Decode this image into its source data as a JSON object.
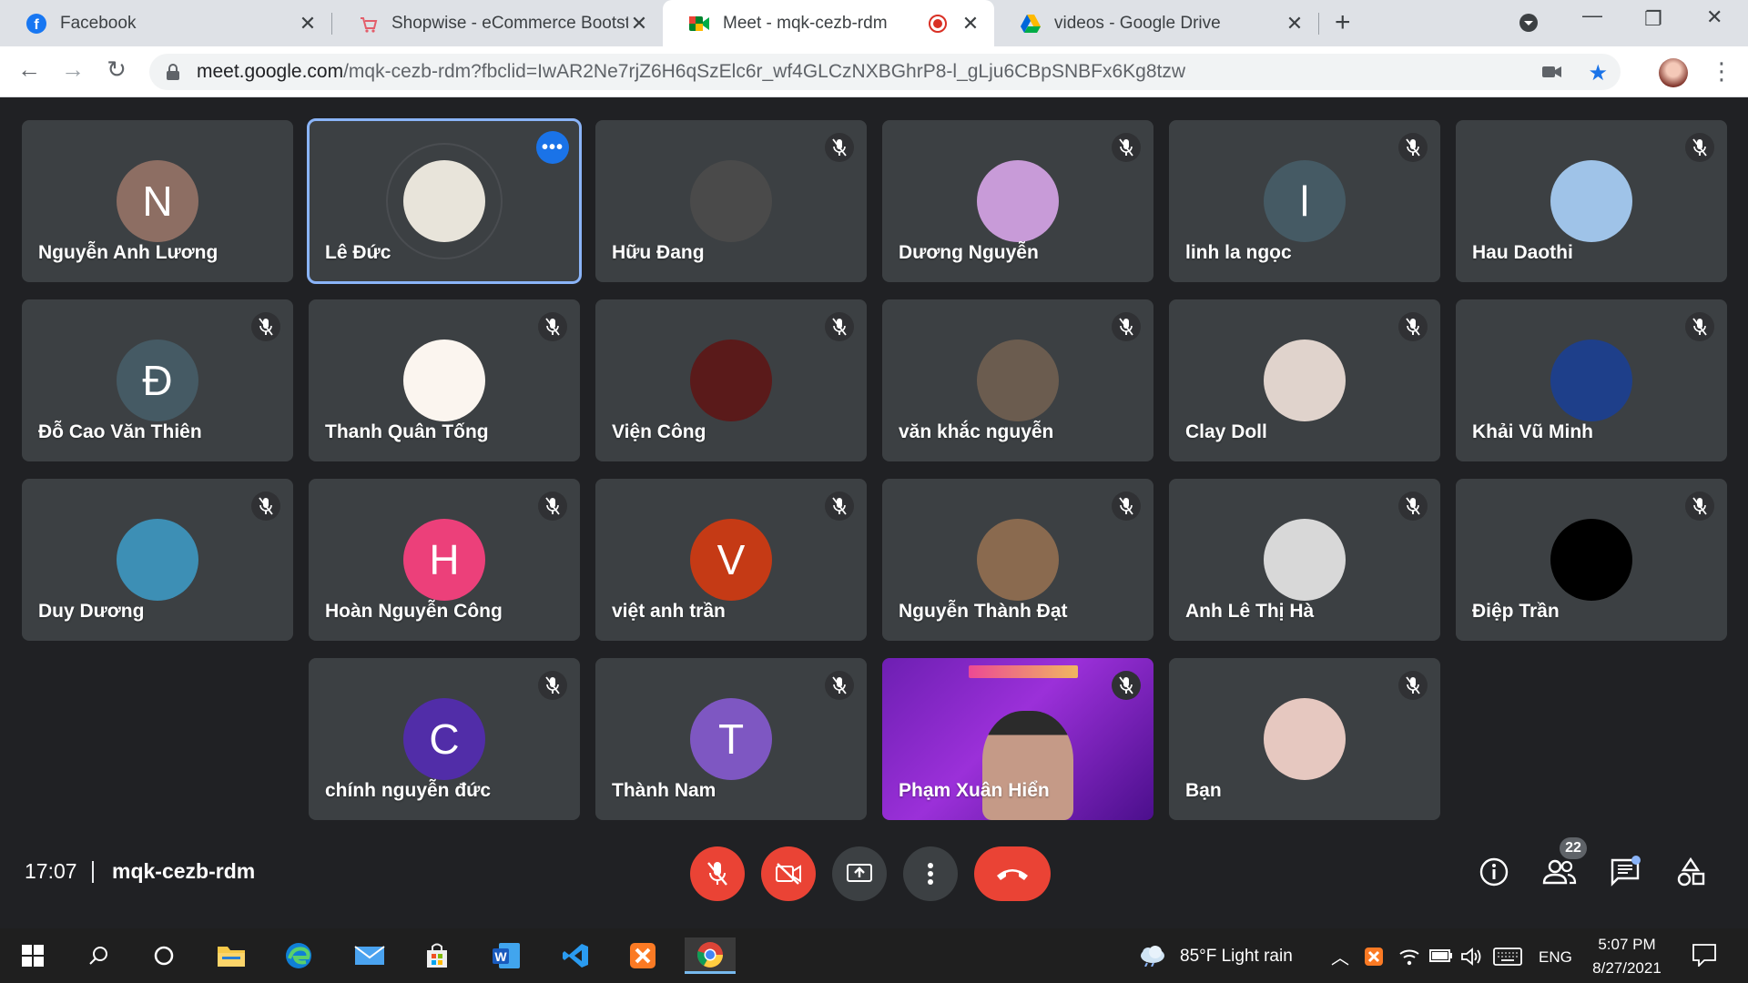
{
  "browser": {
    "tabs": [
      {
        "title": "Facebook",
        "icon": "facebook-icon",
        "active": false
      },
      {
        "title": "Shopwise - eCommerce Bootstra",
        "icon": "shop-icon",
        "active": false
      },
      {
        "title": "Meet - mqk-cezb-rdm",
        "icon": "meet-icon",
        "active": true
      },
      {
        "title": "videos - Google Drive",
        "icon": "drive-icon",
        "active": false
      }
    ],
    "url_host": "meet.google.com",
    "url_path": "/mqk-cezb-rdm?fbclid=IwAR2Ne7rjZ6H6qSzElc6r_wf4GLCzNXBGhrP8-l_gLju6CBpSNBFx6Kg8tzw"
  },
  "participants": [
    {
      "name": "Nguyễn Anh Lương",
      "initial": "N",
      "avatar_color": "#8d6e63",
      "muted": false
    },
    {
      "name": "Lê Đức",
      "initial": "",
      "avatar_color": "#e8e4da",
      "muted": false,
      "speaking": true
    },
    {
      "name": "Hữu Đang",
      "initial": "",
      "avatar_color": "#4a4a4a",
      "muted": true
    },
    {
      "name": "Dương Nguyễn",
      "initial": "",
      "avatar_color": "#c89bd8",
      "muted": true
    },
    {
      "name": "linh la ngọc",
      "initial": "l",
      "avatar_color": "#455a64",
      "muted": true
    },
    {
      "name": "Hau Daothi",
      "initial": "",
      "avatar_color": "#9fc3e8",
      "muted": true
    },
    {
      "name": "Đỗ Cao Văn Thiên",
      "initial": "Đ",
      "avatar_color": "#455a64",
      "muted": true
    },
    {
      "name": "Thanh Quân Tống",
      "initial": "",
      "avatar_color": "#fbf5ef",
      "muted": true
    },
    {
      "name": "Viện Công",
      "initial": "",
      "avatar_color": "#5a1a1a",
      "muted": true
    },
    {
      "name": "văn khắc nguyễn",
      "initial": "",
      "avatar_color": "#6b5c4f",
      "muted": true
    },
    {
      "name": "Clay Doll",
      "initial": "",
      "avatar_color": "#e0d3cc",
      "muted": true
    },
    {
      "name": "Khải Vũ Minh",
      "initial": "",
      "avatar_color": "#1e3f8a",
      "muted": true
    },
    {
      "name": "Duy Dương",
      "initial": "",
      "avatar_color": "#3d8fb5",
      "muted": true
    },
    {
      "name": "Hoàn Nguyễn Công",
      "initial": "H",
      "avatar_color": "#ec407a",
      "muted": true
    },
    {
      "name": "việt anh trần",
      "initial": "V",
      "avatar_color": "#c53a15",
      "muted": true
    },
    {
      "name": "Nguyễn Thành Đạt",
      "initial": "",
      "avatar_color": "#8a6a4f",
      "muted": true
    },
    {
      "name": "Anh Lê Thị Hà",
      "initial": "",
      "avatar_color": "#d8d8d8",
      "muted": true
    },
    {
      "name": "Điệp Trần",
      "initial": "",
      "avatar_color": "#000000",
      "muted": true
    },
    {
      "name": "chính nguyễn đức",
      "initial": "C",
      "avatar_color": "#512da8",
      "muted": true
    },
    {
      "name": "Thành Nam",
      "initial": "T",
      "avatar_color": "#7e57c2",
      "muted": true
    },
    {
      "name": "Phạm Xuân Hiển",
      "initial": "",
      "avatar_color": "#7b2ccf",
      "muted": true,
      "video": true
    },
    {
      "name": "Bạn",
      "initial": "",
      "avatar_color": "#e6c8c0",
      "muted": true
    }
  ],
  "meeting": {
    "time": "17:07",
    "code": "mqk-cezb-rdm",
    "participant_count": "22"
  },
  "taskbar": {
    "weather": "85°F  Light rain",
    "lang": "ENG",
    "time": "5:07 PM",
    "date": "8/27/2021"
  }
}
